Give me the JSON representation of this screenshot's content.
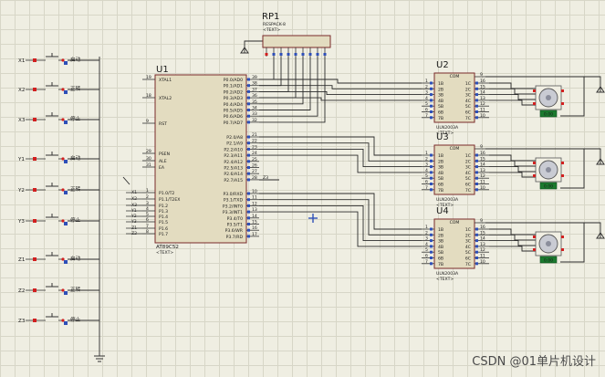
{
  "buttons": [
    {
      "net": "X1",
      "text": "启动"
    },
    {
      "net": "X2",
      "text": "正转"
    },
    {
      "net": "X3",
      "text": "停止"
    },
    {
      "net": "Y1",
      "text": "启动"
    },
    {
      "net": "Y2",
      "text": "正转"
    },
    {
      "net": "Y3",
      "text": "停止"
    },
    {
      "net": "Z1",
      "text": "启动"
    },
    {
      "net": "Z2",
      "text": "正转"
    },
    {
      "net": "Z3",
      "text": "停止"
    }
  ],
  "rp1": {
    "ref": "RP1",
    "part": "RESPACK-8",
    "sub": "<TEXT>"
  },
  "u1": {
    "ref": "U1",
    "part": "AT89C52",
    "sub": "<TEXT>",
    "left_pins": [
      {
        "num": "19",
        "name": "XTAL1"
      },
      {
        "num": "18",
        "name": "XTAL2"
      },
      {
        "num": "9",
        "name": "RST"
      },
      {
        "num": "29",
        "name": "PSEN"
      },
      {
        "num": "30",
        "name": "ALE"
      },
      {
        "num": "31",
        "name": "EA"
      },
      {
        "num": "1",
        "name": "P1.0/T2"
      },
      {
        "num": "2",
        "name": "P1.1/T2EX"
      },
      {
        "num": "3",
        "name": "P1.2"
      },
      {
        "num": "4",
        "name": "P1.3"
      },
      {
        "num": "5",
        "name": "P1.4"
      },
      {
        "num": "6",
        "name": "P1.5"
      },
      {
        "num": "7",
        "name": "P1.6"
      },
      {
        "num": "8",
        "name": "P1.7"
      }
    ],
    "p0_pins": [
      {
        "num": "39",
        "name": "P0.0/AD0"
      },
      {
        "num": "38",
        "name": "P0.1/AD1"
      },
      {
        "num": "37",
        "name": "P0.2/AD2"
      },
      {
        "num": "36",
        "name": "P0.3/AD3"
      },
      {
        "num": "35",
        "name": "P0.4/AD4"
      },
      {
        "num": "34",
        "name": "P0.5/AD5"
      },
      {
        "num": "33",
        "name": "P0.6/AD6"
      },
      {
        "num": "32",
        "name": "P0.7/AD7"
      }
    ],
    "p2_pins": [
      {
        "num": "21",
        "name": "P2.0/A8"
      },
      {
        "num": "22",
        "name": "P2.1/A9"
      },
      {
        "num": "23",
        "name": "P2.2/A10"
      },
      {
        "num": "24",
        "name": "P2.3/A11"
      },
      {
        "num": "25",
        "name": "P2.4/A12"
      },
      {
        "num": "26",
        "name": "P2.5/A13"
      },
      {
        "num": "27",
        "name": "P2.6/A14"
      },
      {
        "num": "28",
        "name": "P2.7/A15"
      }
    ],
    "p3_pins": [
      {
        "num": "10",
        "name": "P3.0/RXD"
      },
      {
        "num": "11",
        "name": "P3.1/TXD"
      },
      {
        "num": "12",
        "name": "P3.2/INT0"
      },
      {
        "num": "13",
        "name": "P3.3/INT1"
      },
      {
        "num": "14",
        "name": "P3.4/T0"
      },
      {
        "num": "15",
        "name": "P3.5/T1"
      },
      {
        "num": "16",
        "name": "P3.6/WR"
      },
      {
        "num": "17",
        "name": "P3.7/RD"
      }
    ],
    "p1_nets": [
      "X1",
      "X2",
      "X3",
      "Y1",
      "Y2",
      "Y3",
      "Z1",
      "Z2"
    ],
    "p2_extra_net": "Z3"
  },
  "drivers": [
    {
      "ref": "U2",
      "part": "ULN2003A",
      "sub": "<TEXT>",
      "com": "COM",
      "left": [
        "1B",
        "2B",
        "3B",
        "4B",
        "5B",
        "6B",
        "7B"
      ],
      "lnum": [
        "1",
        "2",
        "3",
        "4",
        "5",
        "6",
        "7"
      ],
      "right": [
        "1C",
        "2C",
        "3C",
        "4C",
        "5C",
        "6C",
        "7C"
      ],
      "rnum": [
        "16",
        "15",
        "14",
        "13",
        "12",
        "11",
        "10"
      ],
      "top": "9",
      "motor": "0.00"
    },
    {
      "ref": "U3",
      "part": "ULN2003A",
      "sub": "<TEXT>",
      "com": "COM",
      "left": [
        "1B",
        "2B",
        "3B",
        "4B",
        "5B",
        "6B",
        "7B"
      ],
      "lnum": [
        "1",
        "2",
        "3",
        "4",
        "5",
        "6",
        "7"
      ],
      "right": [
        "1C",
        "2C",
        "3C",
        "4C",
        "5C",
        "6C",
        "7C"
      ],
      "rnum": [
        "16",
        "15",
        "14",
        "13",
        "12",
        "11",
        "10"
      ],
      "top": "9",
      "motor": "0.00"
    },
    {
      "ref": "U4",
      "part": "ULN2003A",
      "sub": "<TEXT>",
      "com": "COM",
      "left": [
        "1B",
        "2B",
        "3B",
        "4B",
        "5B",
        "6B",
        "7B"
      ],
      "lnum": [
        "1",
        "2",
        "3",
        "4",
        "5",
        "6",
        "7"
      ],
      "right": [
        "1C",
        "2C",
        "3C",
        "4C",
        "5C",
        "6C",
        "7C"
      ],
      "rnum": [
        "16",
        "15",
        "14",
        "13",
        "12",
        "11",
        "10"
      ],
      "top": "9",
      "motor": "0.00"
    }
  ],
  "watermark": "CSDN @01单片机设计"
}
